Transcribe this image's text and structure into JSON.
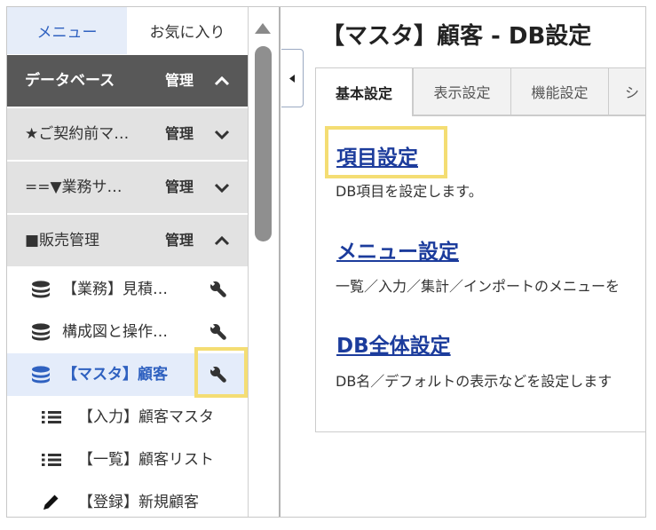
{
  "sidebar": {
    "tabs": [
      {
        "label": "メニュー",
        "active": true
      },
      {
        "label": "お気に入り",
        "active": false
      }
    ],
    "groups": [
      {
        "label": "データベース",
        "manage": "管理",
        "chevron": "chevron-up-icon"
      },
      {
        "label": "★ご契約前マ…",
        "manage": "管理",
        "chevron": "chevron-down-icon"
      },
      {
        "label": "==▼業務サ…",
        "manage": "管理",
        "chevron": "chevron-down-icon"
      },
      {
        "label": "■販売管理",
        "manage": "管理",
        "chevron": "chevron-up-icon"
      }
    ],
    "items": [
      {
        "label": "【業務】見積…",
        "icon": "database-icon",
        "action_icon": "wrench-icon"
      },
      {
        "label": "構成図と操作…",
        "icon": "database-icon",
        "action_icon": "wrench-icon"
      },
      {
        "label": "【マスタ】顧客",
        "icon": "database-icon",
        "action_icon": "wrench-icon",
        "selected": true,
        "highlighted": true
      },
      {
        "label": "【入力】顧客マスタ",
        "icon": "list-icon"
      },
      {
        "label": "【一覧】顧客リスト",
        "icon": "list-icon"
      },
      {
        "label": "【登録】新規顧客",
        "icon": "pencil-icon"
      }
    ],
    "scrollbar_icon": "scroll-up-icon"
  },
  "collapse_button_icon": "caret-left-icon",
  "main": {
    "title": "【マスタ】顧客 - DB設定",
    "tabs": [
      {
        "label": "基本設定",
        "active": true
      },
      {
        "label": "表示設定",
        "active": false
      },
      {
        "label": "機能設定",
        "active": false
      },
      {
        "label": "シ",
        "active": false
      }
    ],
    "sections": [
      {
        "link": "項目設定",
        "description": "DB項目を設定します。",
        "highlighted": true
      },
      {
        "link": "メニュー設定",
        "description": "一覧／入力／集計／インポートのメニューを"
      },
      {
        "link": "DB全体設定",
        "description": "DB名／デフォルトの表示などを設定します"
      }
    ]
  },
  "colors": {
    "accent": "#2f61c0",
    "link": "#1c3c9c",
    "highlight": "#f4dd73",
    "header_bg": "#585858",
    "group_bg": "#e2e2e2",
    "selected_bg": "#e4ecfa"
  }
}
